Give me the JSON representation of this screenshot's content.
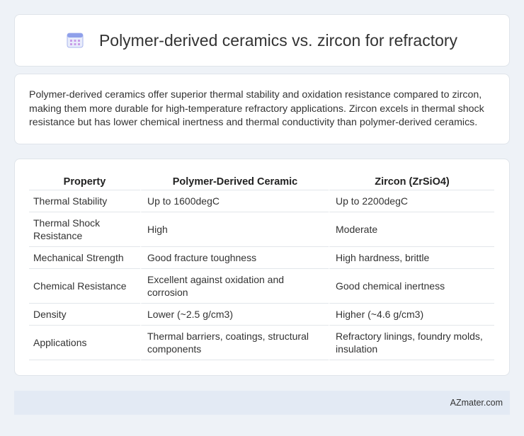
{
  "header": {
    "icon": "calendar-grid-icon",
    "title": "Polymer-derived ceramics vs. zircon for refractory"
  },
  "summary": {
    "text": "Polymer-derived ceramics offer superior thermal stability and oxidation resistance compared to zircon, making them more durable for high-temperature refractory applications. Zircon excels in thermal shock resistance but has lower chemical inertness and thermal conductivity than polymer-derived ceramics."
  },
  "table": {
    "headers": [
      "Property",
      "Polymer-Derived Ceramic",
      "Zircon (ZrSiO4)"
    ],
    "rows": [
      [
        "Thermal Stability",
        "Up to 1600degC",
        "Up to 2200degC"
      ],
      [
        "Thermal Shock Resistance",
        "High",
        "Moderate"
      ],
      [
        "Mechanical Strength",
        "Good fracture toughness",
        "High hardness, brittle"
      ],
      [
        "Chemical Resistance",
        "Excellent against oxidation and corrosion",
        "Good chemical inertness"
      ],
      [
        "Density",
        "Lower (~2.5 g/cm3)",
        "Higher (~4.6 g/cm3)"
      ],
      [
        "Applications",
        "Thermal barriers, coatings, structural components",
        "Refractory linings, foundry molds, insulation"
      ]
    ]
  },
  "footer": {
    "brand": "AZmater.com"
  },
  "colors": {
    "background": "#eef2f7",
    "footer_bg": "#e3eaf4",
    "icon_accent": "#7a8fe0"
  }
}
